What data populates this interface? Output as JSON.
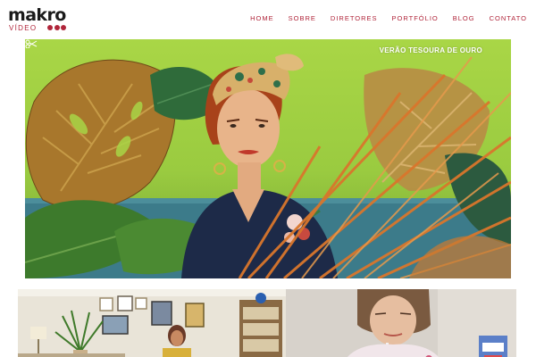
{
  "brand": {
    "name": "makro",
    "subtitle": "VÍDEO",
    "accent_color": "#b0253a"
  },
  "nav": {
    "items": [
      {
        "label": "HOME"
      },
      {
        "label": "SOBRE"
      },
      {
        "label": "DIRETORES"
      },
      {
        "label": "PORTFÓLIO"
      },
      {
        "label": "BLOG"
      },
      {
        "label": "CONTATO"
      }
    ]
  },
  "hero": {
    "title": "VERÃO TESOURA DE OURO",
    "icon": "scissors-icon"
  },
  "portfolio": {
    "second_item_icon": "video-thumbnail"
  }
}
